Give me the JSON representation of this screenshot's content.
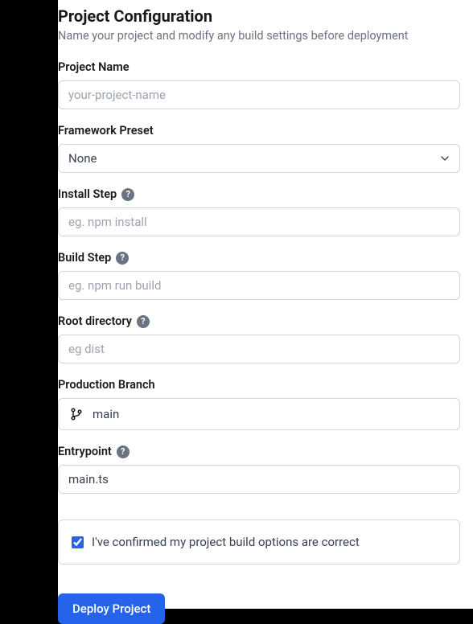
{
  "header": {
    "title": "Project Configuration",
    "subtitle": "Name your project and modify any build settings before deployment"
  },
  "fields": {
    "projectName": {
      "label": "Project Name",
      "placeholder": "your-project-name",
      "value": ""
    },
    "frameworkPreset": {
      "label": "Framework Preset",
      "selected": "None"
    },
    "installStep": {
      "label": "Install Step",
      "placeholder": "eg. npm install",
      "value": ""
    },
    "buildStep": {
      "label": "Build Step",
      "placeholder": "eg. npm run build",
      "value": ""
    },
    "rootDirectory": {
      "label": "Root directory",
      "placeholder": "eg dist",
      "value": ""
    },
    "productionBranch": {
      "label": "Production Branch",
      "value": "main"
    },
    "entrypoint": {
      "label": "Entrypoint",
      "placeholder": "",
      "value": "main.ts"
    }
  },
  "confirm": {
    "label": "I've confirmed my project build options are correct",
    "checked": true
  },
  "actions": {
    "deploy": "Deploy Project"
  }
}
